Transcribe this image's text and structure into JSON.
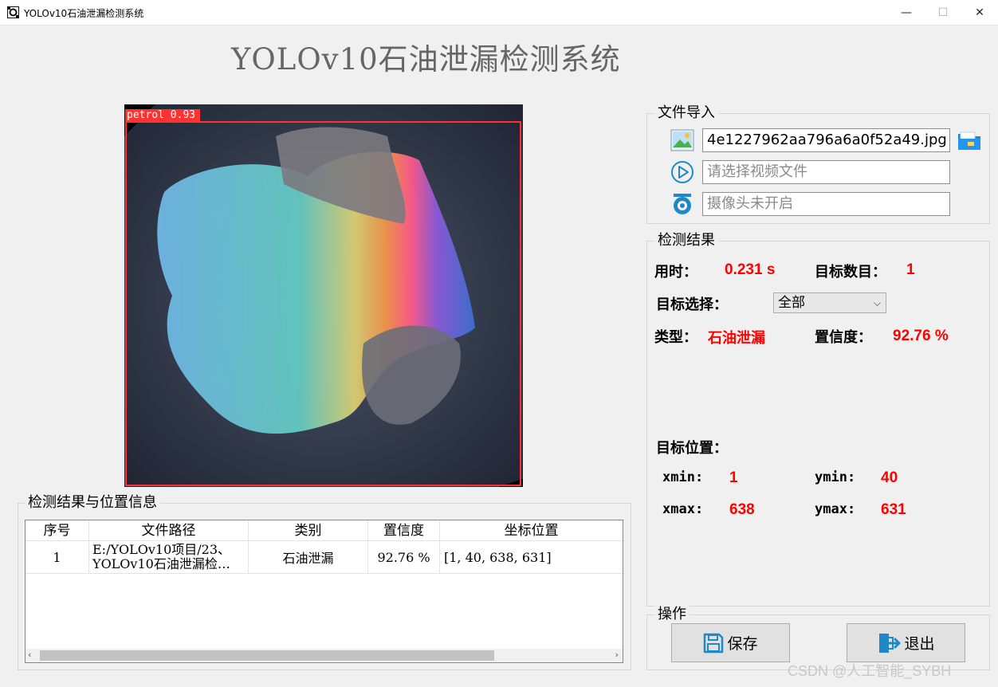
{
  "window": {
    "title": "YOLOv10石油泄漏检测系统",
    "minimize": "—",
    "maximize": "☐",
    "close": "✕"
  },
  "header": {
    "title": "YOLOv10石油泄漏检测系统"
  },
  "image": {
    "detection_label": "petrol 0.93",
    "box_color": "#ff3131"
  },
  "file_import": {
    "title": "文件导入",
    "image_path": "4e1227962aa796a6a0f52a49.jpg",
    "video_placeholder": "请选择视频文件",
    "camera_placeholder": "摄像头未开启"
  },
  "results": {
    "title": "检测结果",
    "time_label": "用时：",
    "time_value": "0.231 s",
    "count_label": "目标数目：",
    "count_value": "1",
    "select_label": "目标选择：",
    "select_value": "全部",
    "type_label": "类型：",
    "type_value": "石油泄漏",
    "conf_label": "置信度：",
    "conf_value": "92.76 %",
    "position_label": "目标位置：",
    "xmin_label": "xmin:",
    "xmin_value": "1",
    "ymin_label": "ymin:",
    "ymin_value": "40",
    "xmax_label": "xmax:",
    "xmax_value": "638",
    "ymax_label": "ymax:",
    "ymax_value": "631"
  },
  "table": {
    "title": "检测结果与位置信息",
    "headers": [
      "序号",
      "文件路径",
      "类别",
      "置信度",
      "坐标位置"
    ],
    "rows": [
      {
        "index": "1",
        "path_line1": "E:/YOLOv10项目/23、",
        "path_line2": "YOLOv10石油泄漏检…",
        "category": "石油泄漏",
        "confidence": "92.76 %",
        "coords": "[1,  40,  638,  631]"
      }
    ]
  },
  "actions": {
    "title": "操作",
    "save": "保存",
    "exit": "退出"
  },
  "watermark": "CSDN @人工智能_SYBH",
  "colors": {
    "accent_red": "#ff0000",
    "icon_blue": "#1e88c9"
  }
}
